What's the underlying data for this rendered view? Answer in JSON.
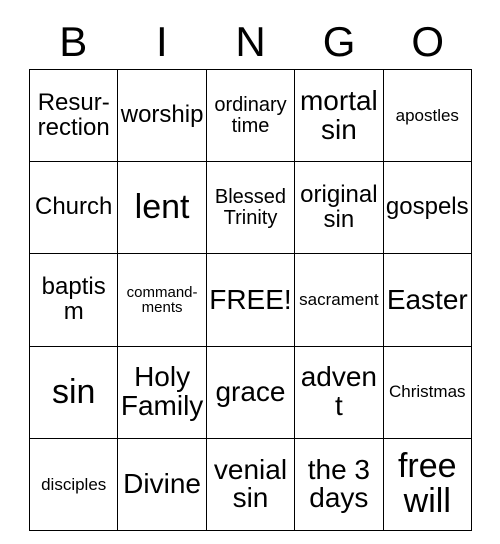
{
  "header": {
    "letters": [
      "B",
      "I",
      "N",
      "G",
      "O"
    ]
  },
  "grid": {
    "rows": [
      [
        {
          "text": "Resur-\nrection",
          "size": "lg"
        },
        {
          "text": "worship",
          "size": "lg"
        },
        {
          "text": "ordinary\ntime",
          "size": "md"
        },
        {
          "text": "mortal\nsin",
          "size": "xl"
        },
        {
          "text": "apostles",
          "size": "sm"
        }
      ],
      [
        {
          "text": "Church",
          "size": "lg"
        },
        {
          "text": "lent",
          "size": "xxl"
        },
        {
          "text": "Blessed\nTrinity",
          "size": "md"
        },
        {
          "text": "original\nsin",
          "size": "lg"
        },
        {
          "text": "gospels",
          "size": "lg"
        }
      ],
      [
        {
          "text": "baptism",
          "size": "lg"
        },
        {
          "text": "command-\nments",
          "size": "xs"
        },
        {
          "text": "FREE!",
          "size": "xl"
        },
        {
          "text": "sacrament",
          "size": "sm"
        },
        {
          "text": "Easter",
          "size": "xl"
        }
      ],
      [
        {
          "text": "sin",
          "size": "xxl"
        },
        {
          "text": "Holy\nFamily",
          "size": "xl"
        },
        {
          "text": "grace",
          "size": "xl"
        },
        {
          "text": "advent",
          "size": "xl"
        },
        {
          "text": "Christmas",
          "size": "sm"
        }
      ],
      [
        {
          "text": "disciples",
          "size": "sm"
        },
        {
          "text": "Divine",
          "size": "xl"
        },
        {
          "text": "venial\nsin",
          "size": "xl"
        },
        {
          "text": "the 3\ndays",
          "size": "xl"
        },
        {
          "text": "free\nwill",
          "size": "xxl"
        }
      ]
    ]
  }
}
